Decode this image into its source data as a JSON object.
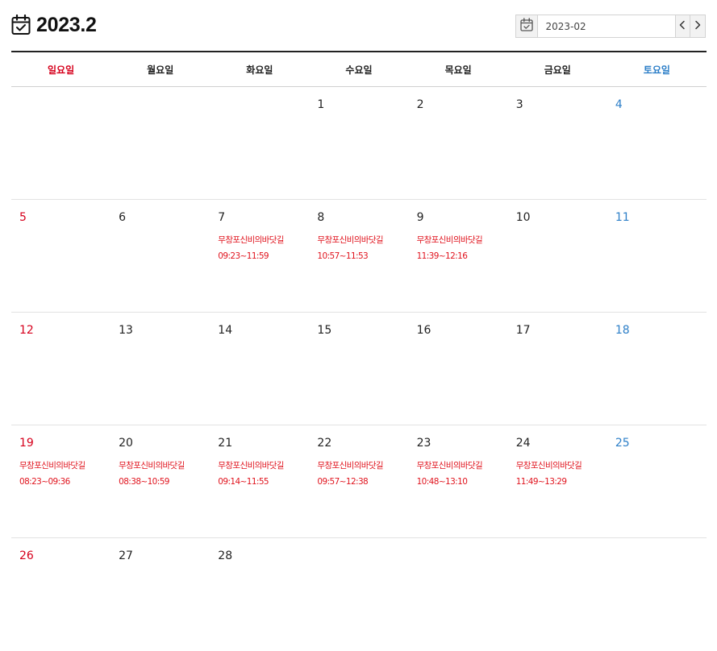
{
  "header": {
    "title": "2023.2",
    "icon": "calendar-check-icon"
  },
  "picker": {
    "value": "2023-02",
    "calendar_icon": "calendar-check-icon",
    "prev_icon": "chevron-left-icon",
    "next_icon": "chevron-right-icon"
  },
  "colors": {
    "sunday": "#d6001c",
    "saturday": "#2d7fc8",
    "event": "#e0141e",
    "title": "#111111"
  },
  "weekdays": [
    "일요일",
    "월요일",
    "화요일",
    "수요일",
    "목요일",
    "금요일",
    "토요일"
  ],
  "weeks": [
    [
      {
        "day": ""
      },
      {
        "day": ""
      },
      {
        "day": ""
      },
      {
        "day": "1"
      },
      {
        "day": "2"
      },
      {
        "day": "3"
      },
      {
        "day": "4"
      }
    ],
    [
      {
        "day": "5"
      },
      {
        "day": "6"
      },
      {
        "day": "7",
        "event": {
          "name": "무창포신비의바닷길",
          "time": "09:23~11:59"
        }
      },
      {
        "day": "8",
        "event": {
          "name": "무창포신비의바닷길",
          "time": "10:57~11:53"
        }
      },
      {
        "day": "9",
        "event": {
          "name": "무창포신비의바닷길",
          "time": "11:39~12:16"
        }
      },
      {
        "day": "10"
      },
      {
        "day": "11"
      }
    ],
    [
      {
        "day": "12"
      },
      {
        "day": "13"
      },
      {
        "day": "14"
      },
      {
        "day": "15"
      },
      {
        "day": "16"
      },
      {
        "day": "17"
      },
      {
        "day": "18"
      }
    ],
    [
      {
        "day": "19",
        "event": {
          "name": "무창포신비의바닷길",
          "time": "08:23~09:36"
        }
      },
      {
        "day": "20",
        "event": {
          "name": "무창포신비의바닷길",
          "time": "08:38~10:59"
        }
      },
      {
        "day": "21",
        "event": {
          "name": "무창포신비의바닷길",
          "time": "09:14~11:55"
        }
      },
      {
        "day": "22",
        "event": {
          "name": "무창포신비의바닷길",
          "time": "09:57~12:38"
        }
      },
      {
        "day": "23",
        "event": {
          "name": "무창포신비의바닷길",
          "time": "10:48~13:10"
        }
      },
      {
        "day": "24",
        "event": {
          "name": "무창포신비의바닷길",
          "time": "11:49~13:29"
        }
      },
      {
        "day": "25"
      }
    ],
    [
      {
        "day": "26"
      },
      {
        "day": "27"
      },
      {
        "day": "28"
      },
      {
        "day": ""
      },
      {
        "day": ""
      },
      {
        "day": ""
      },
      {
        "day": ""
      }
    ]
  ]
}
